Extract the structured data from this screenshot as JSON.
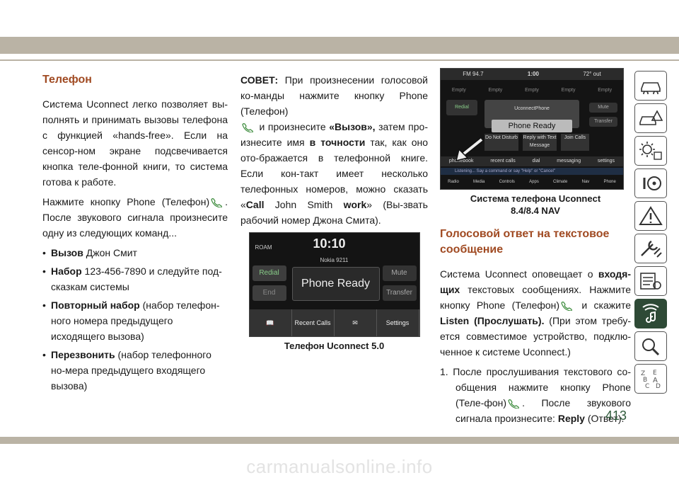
{
  "page_number": "413",
  "watermark": "carmanualsonline.info",
  "col1": {
    "heading": "Телефон",
    "p1": "Система Uconnect легко позволяет вы-полнять и принимать вызовы телефона с функцией «hands-free». Если на сенсор-ном экране подсвечивается кнопка теле-фонной книги, то система готова к работе.",
    "p2a": "Нажмите кнопку Phone (Телефон)",
    "p2b": ". После звукового сигнала произнесите одну из следующих команд...",
    "items": [
      {
        "b": "Вызов",
        "t": " Джон Смит"
      },
      {
        "b": "Набор",
        "t": " 123-456-7890 и следуйте под-сказкам системы"
      },
      {
        "b": "Повторный набор",
        "t": " (набор телефон-ного номера предыдущего исходящего вызова)"
      },
      {
        "b": "Перезвонить",
        "t": " (набор телефонного но-мера предыдущего входящего вызова)"
      }
    ]
  },
  "col2": {
    "tip_label": "СОВЕТ:",
    "tip_1": " При произнесении голосовой ко-манды нажмите кнопку Phone (Телефон)",
    "tip_2": " и произнесите ",
    "tip_call": "«Вызов»,",
    "tip_3": " затем про-изнесите имя ",
    "tip_exact": "в точности",
    "tip_4": " так, как оно ото-бражается в телефонной книге. Если кон-такт имеет несколько телефонных номеров, можно сказать «",
    "tip_call_word": "Call",
    "tip_5": " John Smith ",
    "tip_work": "work",
    "tip_6": "» (Вы-звать рабочий номер Джона Смита).",
    "screen": {
      "roam": "ROAM",
      "time": "10:10",
      "network": "Nokia 9211",
      "redial": "Redial",
      "end": "End",
      "mute": "Mute",
      "transfer": "Transfer",
      "center": "Phone Ready",
      "bar": [
        "",
        "Recent Calls",
        "",
        "Settings"
      ]
    },
    "caption": "Телефон Uconnect 5.0"
  },
  "col3": {
    "screen": {
      "top": [
        "FM 94.7",
        "1:00",
        "72° out"
      ],
      "row": [
        "Empty",
        "Empty",
        "Empty",
        "Empty",
        "Empty"
      ],
      "title": "UconnectPhone",
      "ready": "Phone Ready",
      "redial": "Redial",
      "mute": "Mute",
      "transfer": "Transfer",
      "dnd": "Do Not Disturb",
      "reply": "Reply with Text Message",
      "join": "Join Calls",
      "tabs": [
        "phonebook",
        "recent calls",
        "dial",
        "messaging",
        "settings"
      ],
      "listen": "Listening... Say a command or say \"Help\" or \"Cancel\"",
      "bottom": [
        "Radio",
        "Media",
        "Controls",
        "Apps",
        "Climate",
        "Nav",
        "Phone"
      ]
    },
    "caption_line1": "Система телефона Uconnect",
    "caption_line2": "8.4/8.4 NAV",
    "heading": "Голосовой ответ на текстовое сообщение",
    "p1a": "Система Uconnect оповещает о ",
    "p1b": "входя-щих",
    "p1c": " текстовых сообщениях. Нажмите кнопку Phone (Телефон)",
    "p1d": " и скажите ",
    "p1e": "Listen (Прослушать).",
    "p1f": " (При этом требу-ется совместимое устройство, подклю-ченное к системе Uconnect.)",
    "step_num": "1.",
    "step_a": " После прослушивания текстового со-общения нажмите кнопку Phone (Теле-фон)",
    "step_b": ". После звукового сигнала произнесите: ",
    "step_reply": "Reply",
    "step_c": " (Ответ)."
  },
  "tabs": [
    "car-icon",
    "warning-car-icon",
    "starting-icon",
    "steering-wheel-icon",
    "warning-triangle-icon",
    "tools-icon",
    "specs-icon",
    "multimedia-icon",
    "search-icon",
    "index-icon"
  ],
  "colors": {
    "heading": "#a04a22",
    "band": "#bab3a5",
    "accent_green": "#2e4a36",
    "phone_icon": "#3a8a3a"
  }
}
